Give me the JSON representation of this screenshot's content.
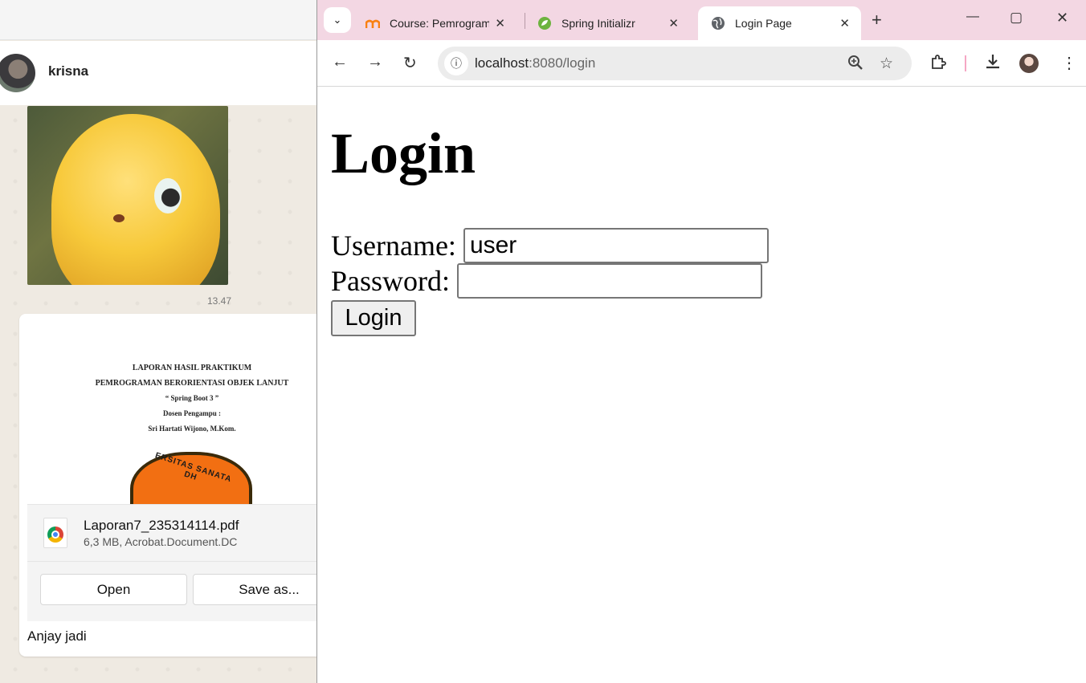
{
  "chat": {
    "contact_name": "krisna",
    "sticker_time": "13.47",
    "document": {
      "preview_lines": [
        "LAPORAN HASIL PRAKTIKUM",
        "PEMROGRAMAN BERORIENTASI OBJEK LANJUT",
        "“ Spring Boot 3 ”",
        "Dosen Pengampu :",
        "Sri Hartati Wijono, M.Kom."
      ],
      "seal_text": "ERSITAS SANATA DH",
      "file_name": "Laporan7_235314114.pdf",
      "file_meta": "6,3 MB, Acrobat.Document.DC",
      "open_label": "Open",
      "save_label": "Save as..."
    },
    "caption": "Anjay jadi"
  },
  "browser": {
    "tabs": [
      {
        "title": "Course: Pemrogram",
        "icon": "moodle-icon",
        "active": false
      },
      {
        "title": "Spring Initializr",
        "icon": "spring-icon",
        "active": false
      },
      {
        "title": "Login Page",
        "icon": "globe-icon",
        "active": true
      }
    ],
    "url_host": "localhost",
    "url_rest": ":8080/login",
    "colors": {
      "tabbar": "#f3d7e3",
      "accent_pink": "#f5a7c4"
    }
  },
  "page": {
    "heading": "Login",
    "username_label": "Username:",
    "username_value": "user",
    "password_label": "Password:",
    "password_value": "",
    "login_button": "Login"
  }
}
